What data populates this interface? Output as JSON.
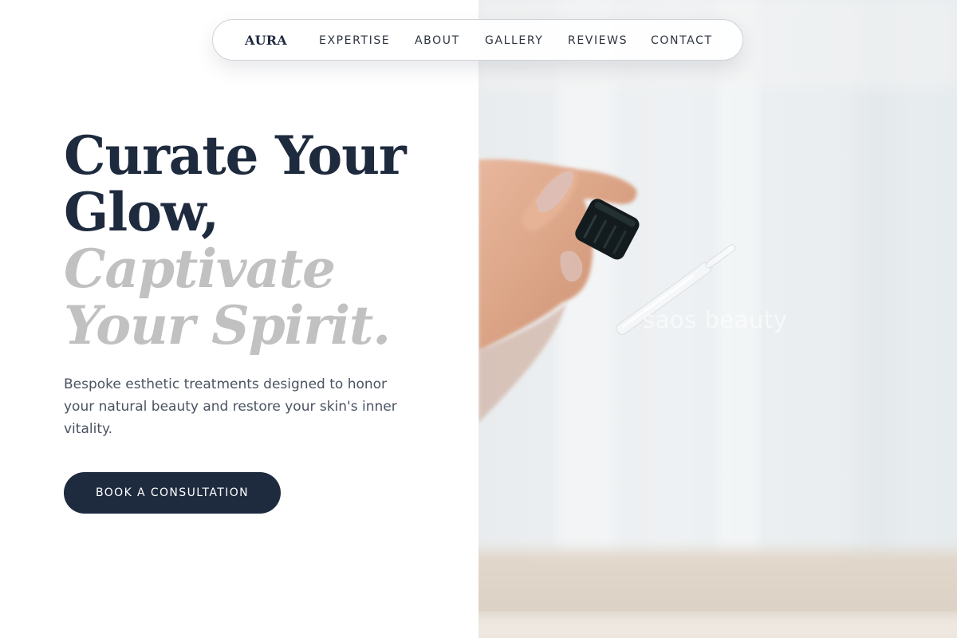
{
  "nav": {
    "logo": "AURA",
    "links": [
      "EXPERTISE",
      "ABOUT",
      "GALLERY",
      "REVIEWS",
      "CONTACT"
    ]
  },
  "hero": {
    "headline_line1": "Curate Your",
    "headline_line2": "Glow,",
    "headline_line3": "Captivate",
    "headline_line4": "Your Spirit.",
    "description": "Bespoke esthetic treatments designed to honor your natural beauty and restore your skin's inner vitality.",
    "cta_label": "BOOK A CONSULTATION"
  },
  "image": {
    "watermark": "saos beauty",
    "subject": "hand holding glass dropper"
  },
  "colors": {
    "primary": "#1e2a3e",
    "muted_heading": "#c1c1c1",
    "body_text": "#4a5362",
    "background": "#ffffff"
  }
}
